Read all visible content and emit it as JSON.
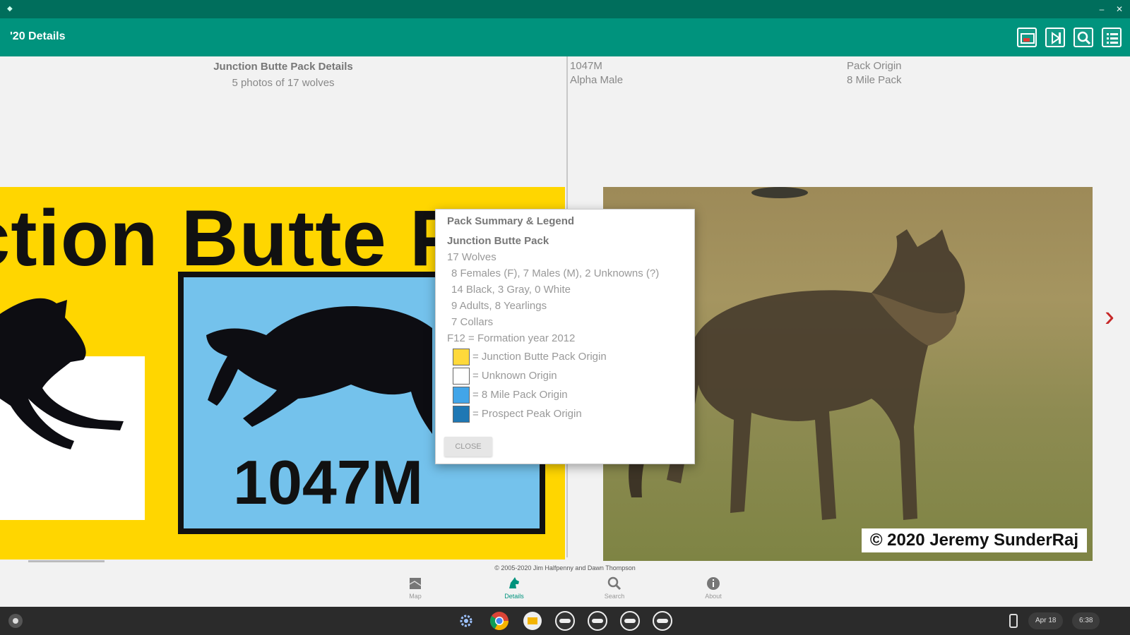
{
  "window": {
    "minimize_label": "–",
    "close_label": "✕"
  },
  "appbar": {
    "title": "'20 Details"
  },
  "left_pane": {
    "title": "Junction Butte Pack Details",
    "subtitle": "5 photos of 17 wolves",
    "image": {
      "pack_name_text": "ction Butte P",
      "wolf_id": "1047M"
    }
  },
  "right_pane": {
    "wolf_id": "1047M",
    "role": "Alpha Male",
    "origin_label": "Pack Origin",
    "origin_value": "8 Mile Pack",
    "photo_credit": "© 2020 Jeremy SunderRaj"
  },
  "dialog": {
    "title": "Pack Summary & Legend",
    "pack_name": "Junction Butte Pack",
    "total": "17 Wolves",
    "lines": [
      "8 Females (F), 7 Males (M), 2 Unknowns (?)",
      "14 Black, 3 Gray, 0 White",
      "9 Adults, 8 Yearlings",
      "7 Collars"
    ],
    "formation": "F12 = Formation year 2012",
    "legend": [
      {
        "label": "= Junction Butte Pack Origin",
        "color": "#ffd93b"
      },
      {
        "label": "= Unknown Origin",
        "color": "#ffffff"
      },
      {
        "label": "= 8 Mile Pack Origin",
        "color": "#42a5e8"
      },
      {
        "label": "= Prospect Peak Origin",
        "color": "#1f78b4"
      }
    ],
    "close_label": "CLOSE"
  },
  "footer": {
    "copyright": "© 2005-2020 Jim Halfpenny and Dawn Thompson"
  },
  "bottom_nav": [
    {
      "label": "Map",
      "icon": "map-icon"
    },
    {
      "label": "Details",
      "icon": "wolf-icon",
      "active": true
    },
    {
      "label": "Search",
      "icon": "search-icon"
    },
    {
      "label": "About",
      "icon": "info-icon"
    }
  ],
  "shelf": {
    "date": "Apr 18",
    "time": "6:38"
  },
  "colors": {
    "titlebar": "#006e5c",
    "appbar": "#00937d",
    "yellow": "#ffd600",
    "blue": "#74c2ec",
    "arrow": "#c62828"
  }
}
